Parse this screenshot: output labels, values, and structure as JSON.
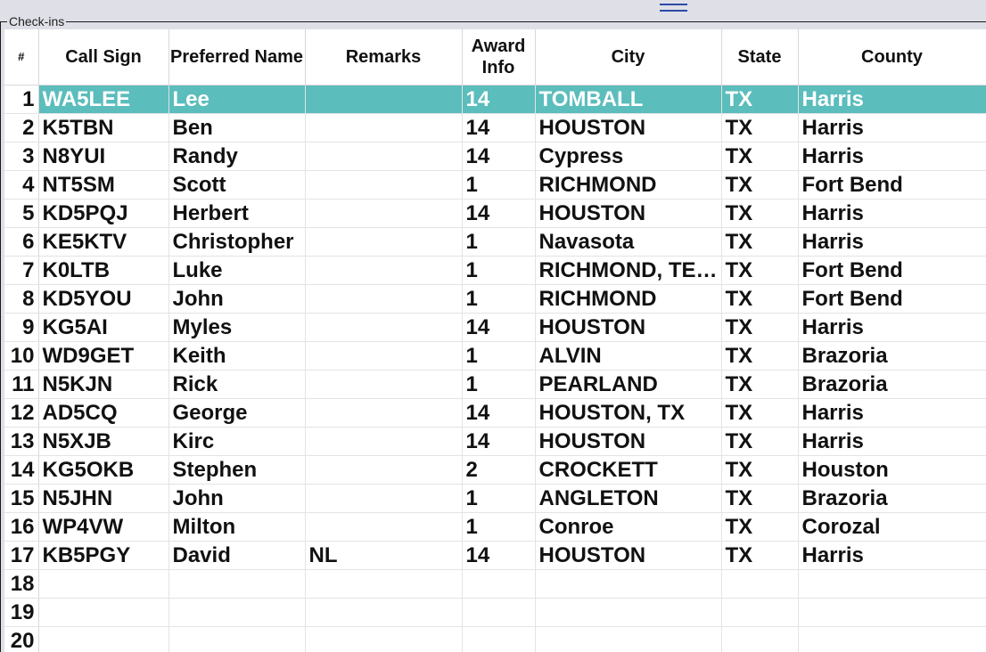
{
  "group": {
    "title": "Check-ins"
  },
  "columns": [
    {
      "key": "num",
      "label": "#"
    },
    {
      "key": "call",
      "label": "Call Sign"
    },
    {
      "key": "name",
      "label": "Preferred Name"
    },
    {
      "key": "remarks",
      "label": "Remarks"
    },
    {
      "key": "award",
      "label": "Award Info"
    },
    {
      "key": "city",
      "label": "City"
    },
    {
      "key": "state",
      "label": "State"
    },
    {
      "key": "county",
      "label": "County"
    }
  ],
  "rows": [
    {
      "num": "1",
      "call": "WA5LEE",
      "name": "Lee",
      "remarks": "",
      "award": "14",
      "city": "TOMBALL",
      "state": "TX",
      "county": "Harris"
    },
    {
      "num": "2",
      "call": "K5TBN",
      "name": "Ben",
      "remarks": "",
      "award": "14",
      "city": "HOUSTON",
      "state": "TX",
      "county": "Harris"
    },
    {
      "num": "3",
      "call": "N8YUI",
      "name": "Randy",
      "remarks": "",
      "award": "14",
      "city": "Cypress",
      "state": "TX",
      "county": "Harris"
    },
    {
      "num": "4",
      "call": "NT5SM",
      "name": "Scott",
      "remarks": "",
      "award": "1",
      "city": "RICHMOND",
      "state": "TX",
      "county": "Fort Bend"
    },
    {
      "num": "5",
      "call": "KD5PQJ",
      "name": "Herbert",
      "remarks": "",
      "award": "14",
      "city": "HOUSTON",
      "state": "TX",
      "county": "Harris"
    },
    {
      "num": "6",
      "call": "KE5KTV",
      "name": "Christopher",
      "remarks": "",
      "award": "1",
      "city": "Navasota",
      "state": "TX",
      "county": "Harris"
    },
    {
      "num": "7",
      "call": "K0LTB",
      "name": "Luke",
      "remarks": "",
      "award": "1",
      "city": "RICHMOND, TE…",
      "state": "TX",
      "county": "Fort Bend"
    },
    {
      "num": "8",
      "call": "KD5YOU",
      "name": "John",
      "remarks": "",
      "award": "1",
      "city": "RICHMOND",
      "state": "TX",
      "county": "Fort Bend"
    },
    {
      "num": "9",
      "call": "KG5AI",
      "name": "Myles",
      "remarks": "",
      "award": "14",
      "city": "HOUSTON",
      "state": "TX",
      "county": "Harris"
    },
    {
      "num": "10",
      "call": "WD9GET",
      "name": "Keith",
      "remarks": "",
      "award": "1",
      "city": "ALVIN",
      "state": "TX",
      "county": "Brazoria"
    },
    {
      "num": "11",
      "call": "N5KJN",
      "name": "Rick",
      "remarks": "",
      "award": "1",
      "city": "PEARLAND",
      "state": "TX",
      "county": "Brazoria"
    },
    {
      "num": "12",
      "call": "AD5CQ",
      "name": "George",
      "remarks": "",
      "award": "14",
      "city": "HOUSTON, TX",
      "state": "TX",
      "county": "Harris"
    },
    {
      "num": "13",
      "call": "N5XJB",
      "name": "Kirc",
      "remarks": "",
      "award": "14",
      "city": "HOUSTON",
      "state": "TX",
      "county": "Harris"
    },
    {
      "num": "14",
      "call": "KG5OKB",
      "name": "Stephen",
      "remarks": "",
      "award": "2",
      "city": "CROCKETT",
      "state": "TX",
      "county": "Houston"
    },
    {
      "num": "15",
      "call": "N5JHN",
      "name": "John",
      "remarks": "",
      "award": "1",
      "city": "ANGLETON",
      "state": "TX",
      "county": "Brazoria"
    },
    {
      "num": "16",
      "call": "WP4VW",
      "name": "Milton",
      "remarks": "",
      "award": "1",
      "city": "Conroe",
      "state": "TX",
      "county": "Corozal"
    },
    {
      "num": "17",
      "call": "KB5PGY",
      "name": "David",
      "remarks": "NL",
      "award": "14",
      "city": "HOUSTON",
      "state": "TX",
      "county": "Harris"
    },
    {
      "num": "18",
      "call": "",
      "name": "",
      "remarks": "",
      "award": "",
      "city": "",
      "state": "",
      "county": ""
    },
    {
      "num": "19",
      "call": "",
      "name": "",
      "remarks": "",
      "award": "",
      "city": "",
      "state": "",
      "county": ""
    },
    {
      "num": "20",
      "call": "",
      "name": "",
      "remarks": "",
      "award": "",
      "city": "",
      "state": "",
      "county": ""
    }
  ],
  "selected_row": 0,
  "colors": {
    "selection": "#5bbdbc",
    "selection_text": "#ffffff",
    "window_bg": "#dfe0e7",
    "splitter": "#2b4aa8"
  }
}
